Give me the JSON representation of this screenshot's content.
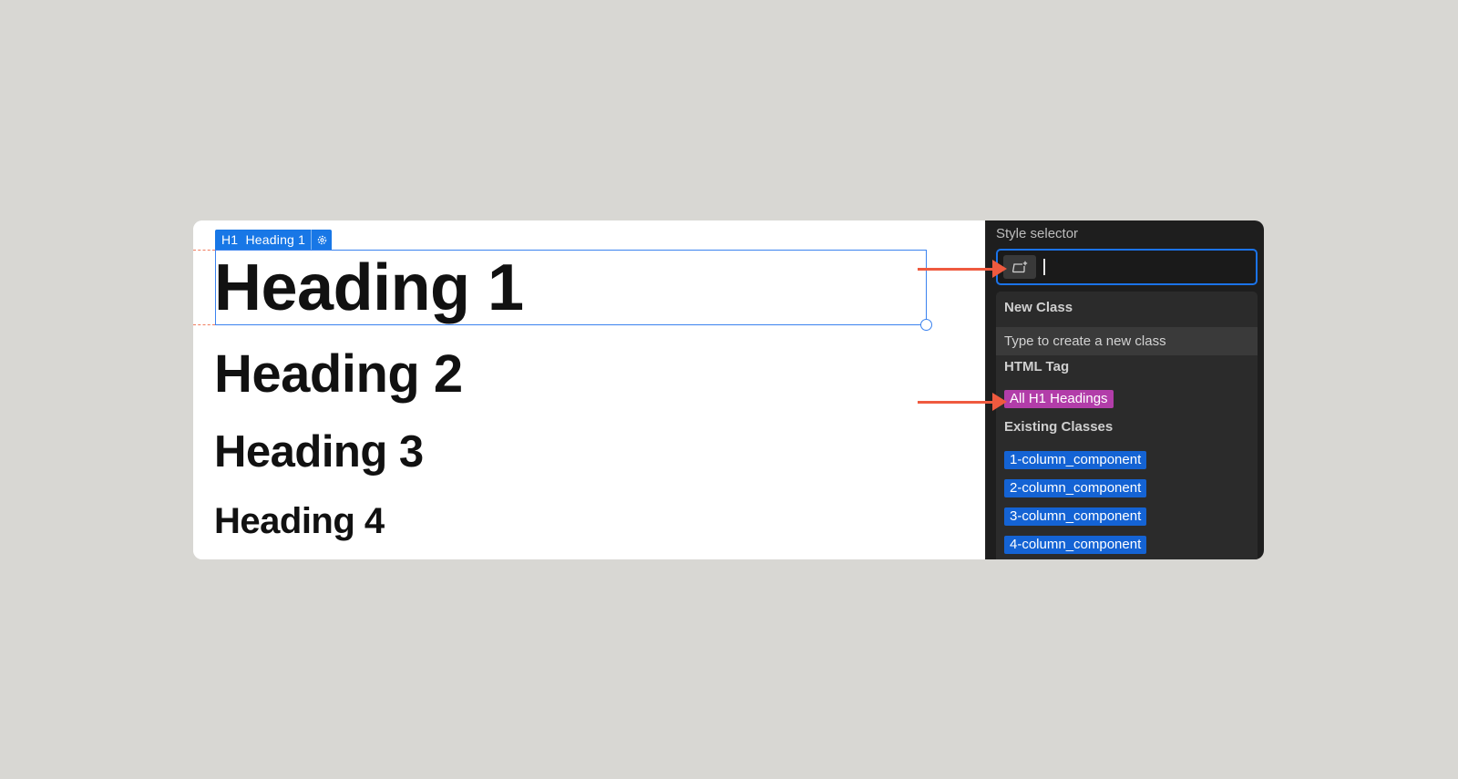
{
  "canvas": {
    "badge": {
      "tag": "H1",
      "label": "Heading 1",
      "icon": "gear-icon"
    },
    "headings": [
      "Heading 1",
      "Heading 2",
      "Heading 3",
      "Heading 4"
    ]
  },
  "panel": {
    "title": "Style selector",
    "search": {
      "value": "",
      "placeholder": "",
      "icon": "add-class-icon"
    },
    "new_class": {
      "header": "New Class",
      "hint": "Type to create a new class"
    },
    "html_tag": {
      "header": "HTML Tag",
      "item": "All H1 Headings"
    },
    "existing": {
      "header": "Existing Classes",
      "items": [
        "1-column_component",
        "2-column_component",
        "3-column_component",
        "4-column_component"
      ]
    }
  },
  "colors": {
    "selection": "#3a82ef",
    "badge": "#1877e6",
    "tag_pill": "#b23da9",
    "class_pill": "#1463d4",
    "annotation_arrow": "#ef5a3f"
  }
}
